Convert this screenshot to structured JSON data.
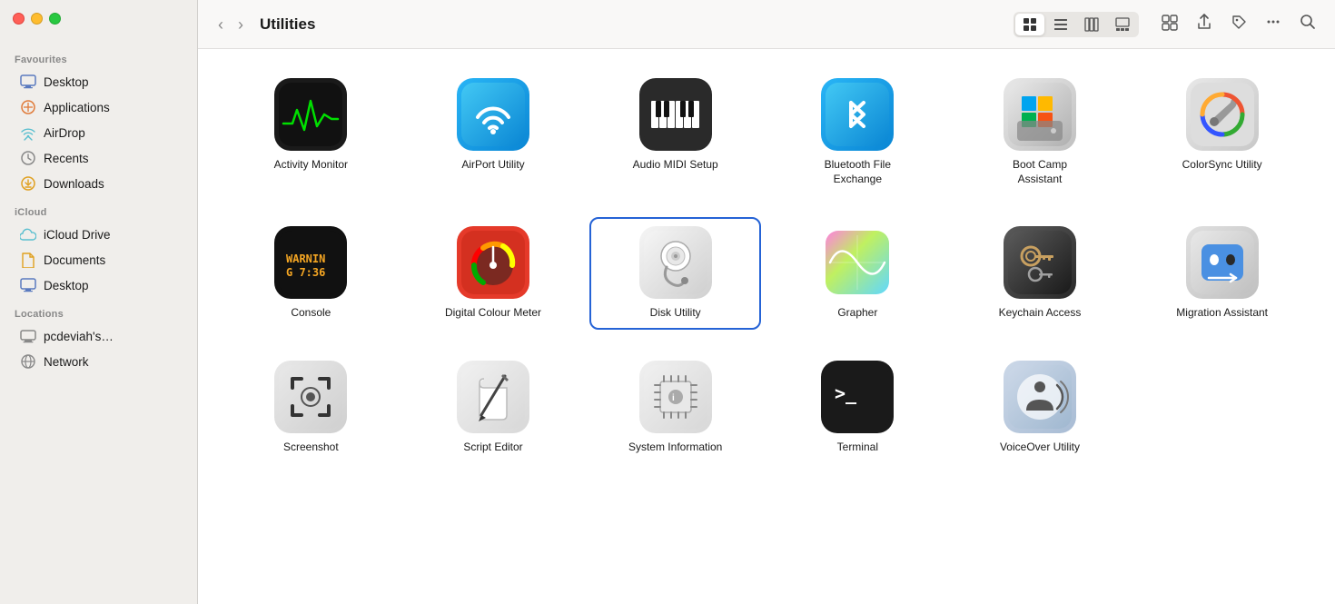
{
  "window": {
    "title": "Utilities"
  },
  "traffic_lights": {
    "close_label": "Close",
    "minimize_label": "Minimize",
    "maximize_label": "Maximize"
  },
  "toolbar": {
    "back_label": "‹",
    "forward_label": "›",
    "title": "Utilities",
    "view_grid_label": "⊞",
    "view_list_label": "☰",
    "view_columns_label": "⊟",
    "view_gallery_label": "⊡",
    "arrange_label": "⊞",
    "share_label": "↑",
    "tag_label": "◇",
    "more_label": "•••",
    "search_label": "🔍"
  },
  "sidebar": {
    "sections": [
      {
        "label": "Favourites",
        "items": [
          {
            "id": "desktop",
            "label": "Desktop",
            "icon": "🖥"
          },
          {
            "id": "applications",
            "label": "Applications",
            "icon": "🚀"
          },
          {
            "id": "airdrop",
            "label": "AirDrop",
            "icon": "📡"
          },
          {
            "id": "recents",
            "label": "Recents",
            "icon": "🕐"
          },
          {
            "id": "downloads",
            "label": "Downloads",
            "icon": "⬇"
          }
        ]
      },
      {
        "label": "iCloud",
        "items": [
          {
            "id": "icloud-drive",
            "label": "iCloud Drive",
            "icon": "☁"
          },
          {
            "id": "documents",
            "label": "Documents",
            "icon": "📄"
          },
          {
            "id": "desktop2",
            "label": "Desktop",
            "icon": "🖥"
          }
        ]
      },
      {
        "label": "Locations",
        "items": [
          {
            "id": "computer",
            "label": "pcdeviah's…",
            "icon": "💻"
          },
          {
            "id": "network",
            "label": "Network",
            "icon": "🌐"
          }
        ]
      }
    ]
  },
  "apps": [
    {
      "id": "activity-monitor",
      "label": "Activity Monitor",
      "selected": false
    },
    {
      "id": "airport-utility",
      "label": "AirPort Utility",
      "selected": false
    },
    {
      "id": "audio-midi",
      "label": "Audio MIDI Setup",
      "selected": false
    },
    {
      "id": "bluetooth-file-exchange",
      "label": "Bluetooth File Exchange",
      "selected": false
    },
    {
      "id": "boot-camp-assistant",
      "label": "Boot Camp Assistant",
      "selected": false
    },
    {
      "id": "colorsync-utility",
      "label": "ColorSync Utility",
      "selected": false
    },
    {
      "id": "console",
      "label": "Console",
      "selected": false
    },
    {
      "id": "digital-colour-meter",
      "label": "Digital Colour Meter",
      "selected": false
    },
    {
      "id": "disk-utility",
      "label": "Disk Utility",
      "selected": true
    },
    {
      "id": "grapher",
      "label": "Grapher",
      "selected": false
    },
    {
      "id": "keychain-access",
      "label": "Keychain Access",
      "selected": false
    },
    {
      "id": "migration-assistant",
      "label": "Migration Assistant",
      "selected": false
    },
    {
      "id": "screenshot",
      "label": "Screenshot",
      "selected": false
    },
    {
      "id": "script-editor",
      "label": "Script Editor",
      "selected": false
    },
    {
      "id": "system-information",
      "label": "System Information",
      "selected": false
    },
    {
      "id": "terminal",
      "label": "Terminal",
      "selected": false
    },
    {
      "id": "voiceover-utility",
      "label": "VoiceOver Utility",
      "selected": false
    }
  ]
}
